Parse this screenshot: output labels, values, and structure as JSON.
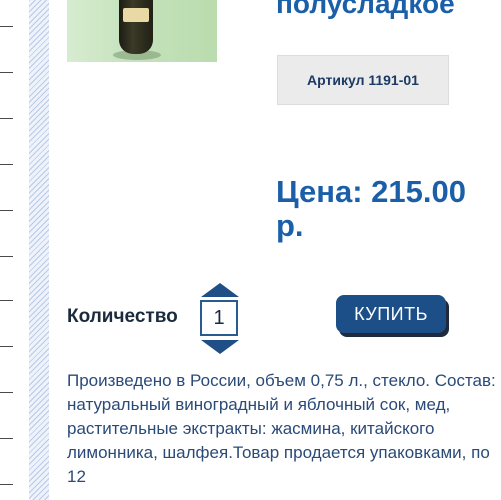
{
  "product": {
    "title_visible": "полусладкое",
    "image_icon": "wine-bottle-image",
    "sku_label": "Артикул 1191-01",
    "price_label": "Цена: 215.00 р."
  },
  "purchase": {
    "quantity_label": "Количество",
    "quantity_value": "1",
    "buy_label": "КУПИТЬ"
  },
  "description": "Произведено в России, объем 0,75 л., стекло. Состав: натуральный виноградный и яблочный сок, мед, растительные экстракты: жасмина, китайского лимонника, шалфея.Товар продается упаковками, по 12",
  "colors": {
    "accent": "#1a5fa8",
    "button": "#1c4f88",
    "text": "#2a4a78"
  }
}
